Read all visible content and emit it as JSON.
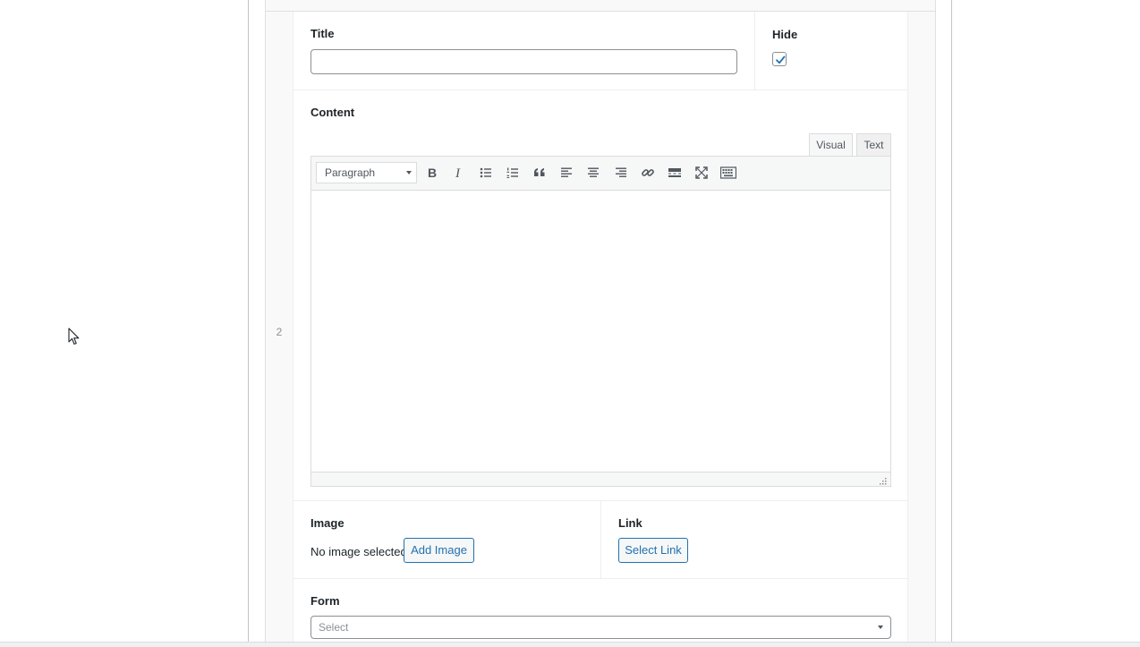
{
  "row": {
    "number": "2"
  },
  "fields": {
    "title": {
      "label": "Title",
      "value": "",
      "placeholder": ""
    },
    "hide": {
      "label": "Hide",
      "checked": true
    },
    "content": {
      "label": "Content",
      "tabs": {
        "visual": "Visual",
        "text": "Text"
      },
      "active_tab": "Visual",
      "format_select": "Paragraph",
      "toolbar_icons": [
        "bold-icon",
        "italic-icon",
        "bullet-list-icon",
        "numbered-list-icon",
        "blockquote-icon",
        "align-left-icon",
        "align-center-icon",
        "align-right-icon",
        "link-icon",
        "read-more-icon",
        "fullscreen-icon",
        "toolbar-toggle-icon"
      ]
    },
    "image": {
      "label": "Image",
      "status": "No image selected",
      "button": "Add Image"
    },
    "link": {
      "label": "Link",
      "button": "Select Link"
    },
    "form": {
      "label": "Form",
      "placeholder": "Select"
    }
  },
  "colors": {
    "accent": "#2271b1",
    "checkbox_check": "#2271b1"
  }
}
